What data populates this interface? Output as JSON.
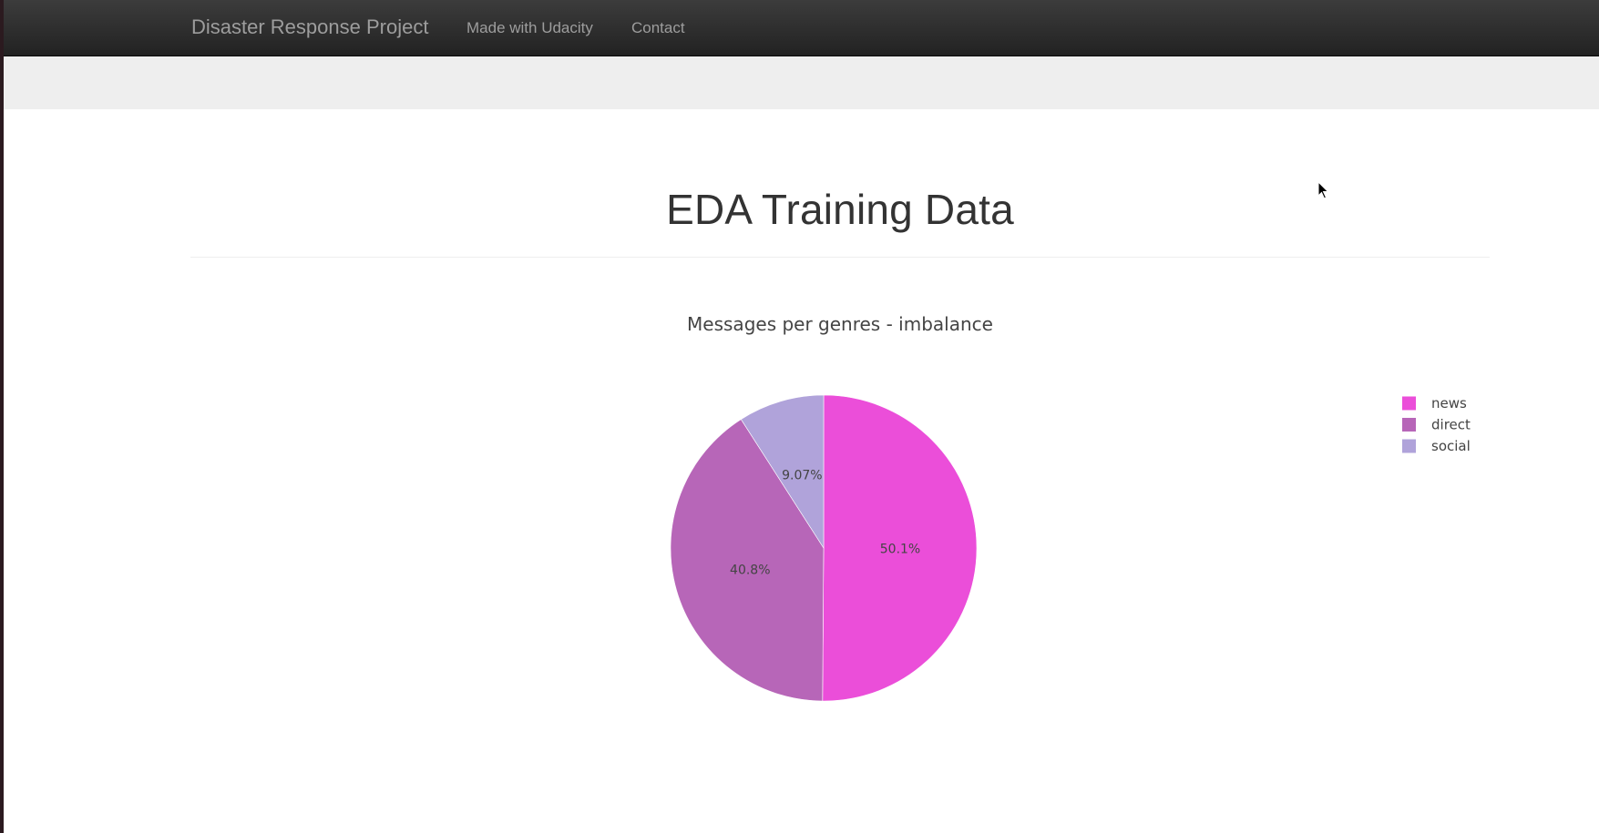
{
  "navbar": {
    "brand": "Disaster Response Project",
    "links": [
      {
        "label": "Made with Udacity"
      },
      {
        "label": "Contact"
      }
    ]
  },
  "page": {
    "title": "EDA Training Data"
  },
  "chart_data": {
    "type": "pie",
    "title": "Messages per genres - imbalance",
    "categories": [
      "news",
      "direct",
      "social"
    ],
    "values": [
      50.1,
      40.8,
      9.07
    ],
    "labels": [
      "50.1%",
      "40.8%",
      "9.07%"
    ],
    "colors": [
      "#eb4ed9",
      "#b766b8",
      "#b0a3da"
    ],
    "legend_position": "top-right"
  }
}
